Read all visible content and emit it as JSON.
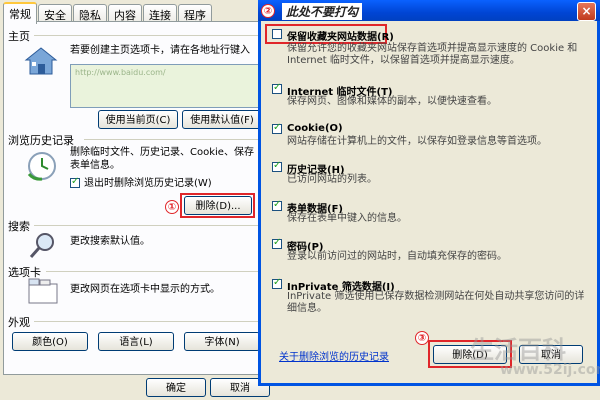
{
  "options": {
    "tabs": [
      "常规",
      "安全",
      "隐私",
      "内容",
      "连接",
      "程序"
    ],
    "home": {
      "title": "主页",
      "desc": "若要创建主页选项卡，请在各地址行键入",
      "url": "http://www.baidu.com/",
      "use_current": "使用当前页(C)",
      "use_default": "使用默认值(F)"
    },
    "history": {
      "title": "浏览历史记录",
      "desc_line1": "删除临时文件、历史记录、Cookie、保存",
      "desc_line2": "表单信息。",
      "exit_delete": "退出时删除浏览历史记录(W)",
      "delete_btn": "删除(D)..."
    },
    "search": {
      "title": "搜索",
      "desc": "更改搜索默认值。"
    },
    "tabsec": {
      "title": "选项卡",
      "desc": "更改网页在选项卡中显示的方式。"
    },
    "appearance": {
      "title": "外观",
      "colors": "颜色(O)",
      "languages": "语言(L)",
      "fonts": "字体(N)"
    },
    "ok": "确定",
    "cancel": "取消"
  },
  "dialog": {
    "title": "此处不要打勾",
    "close": "×",
    "items": [
      {
        "title": "保留收藏夹网站数据(R)",
        "desc": "保留允许您的收藏夹网站保存首选项并提高显示速度的 Cookie 和 Internet 临时文件，以保留首选项并提高显示速度。",
        "checked": false
      },
      {
        "title": "Internet 临时文件(T)",
        "desc": "保存网页、图像和媒体的副本，以便快速查看。",
        "checked": true
      },
      {
        "title": "Cookie(O)",
        "desc": "网站存储在计算机上的文件，以保存如登录信息等首选项。",
        "checked": true
      },
      {
        "title": "历史记录(H)",
        "desc": "已访问网站的列表。",
        "checked": true
      },
      {
        "title": "表单数据(F)",
        "desc": "保存在表单中键入的信息。",
        "checked": true
      },
      {
        "title": "密码(P)",
        "desc": "登录以前访问过的网站时，自动填充保存的密码。",
        "checked": true
      },
      {
        "title": "InPrivate 筛选数据(I)",
        "desc": "InPrivate 筛选使用已保存数据检测网站在何处自动共享您访问的详细信息。",
        "checked": true
      }
    ],
    "about_link": "关于删除浏览的历史记录",
    "delete": "删除(D)",
    "cancel": "取消"
  },
  "markers": [
    "①",
    "②",
    "③"
  ],
  "watermark": {
    "brand": "生活百科",
    "site": "www.52ij.com"
  },
  "colors": {
    "highlight": "#e0262a",
    "titlebar": "#0054e3",
    "check": "#21a121"
  }
}
